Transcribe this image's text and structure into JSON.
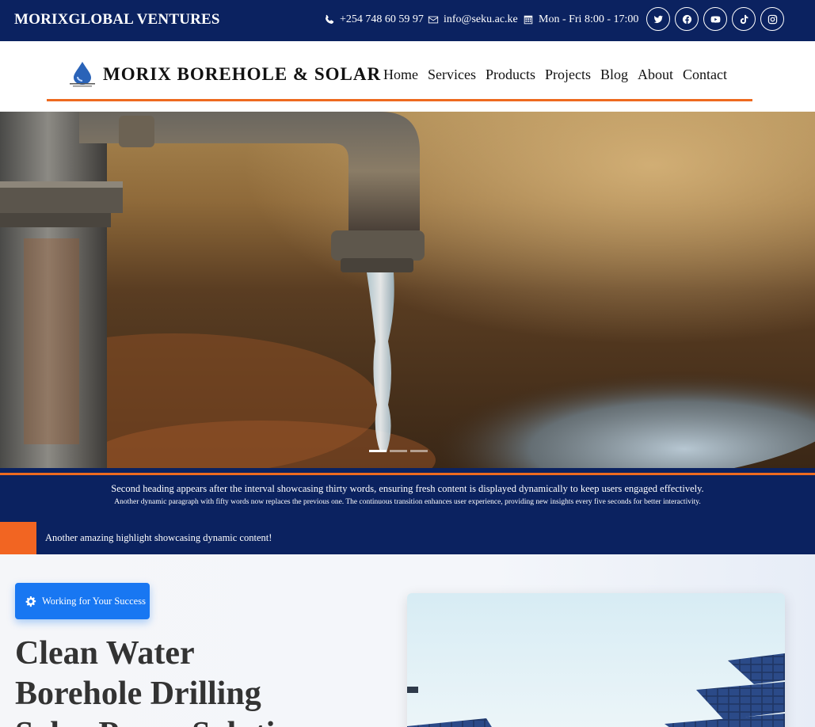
{
  "topbar": {
    "brand": "MORIXGLOBAL VENTURES",
    "phone": "+254 748 60 59 97",
    "email": "info@seku.ac.ke",
    "hours": "Mon - Fri 8:00 - 17:00",
    "socials": [
      "twitter-icon",
      "facebook-icon",
      "youtube-icon",
      "tiktok-icon",
      "instagram-icon"
    ]
  },
  "navbar": {
    "brand": "MORIX BOREHOLE & SOLAR",
    "items": [
      "Home",
      "Services",
      "Products",
      "Projects",
      "Blog",
      "About",
      "Contact"
    ]
  },
  "hero": {
    "slides": 3,
    "active_slide": 1
  },
  "banner": {
    "heading": "Second heading appears after the interval showcasing thirty words, ensuring fresh content is displayed dynamically to keep users engaged effectively.",
    "paragraph": "Another dynamic paragraph with fifty words now replaces the previous one. The continuous transition enhances user experience, providing new insights every five seconds for better interactivity."
  },
  "ticker": {
    "text": "Another amazing highlight showcasing dynamic content!"
  },
  "main": {
    "badge": "Working for Your Success",
    "headline_lines": [
      "Clean Water",
      "Borehole Drilling",
      "Solar Pump Solutions"
    ]
  },
  "colors": {
    "navy": "#0b2260",
    "orange": "#ee6a1f",
    "blue": "#1877f2"
  }
}
